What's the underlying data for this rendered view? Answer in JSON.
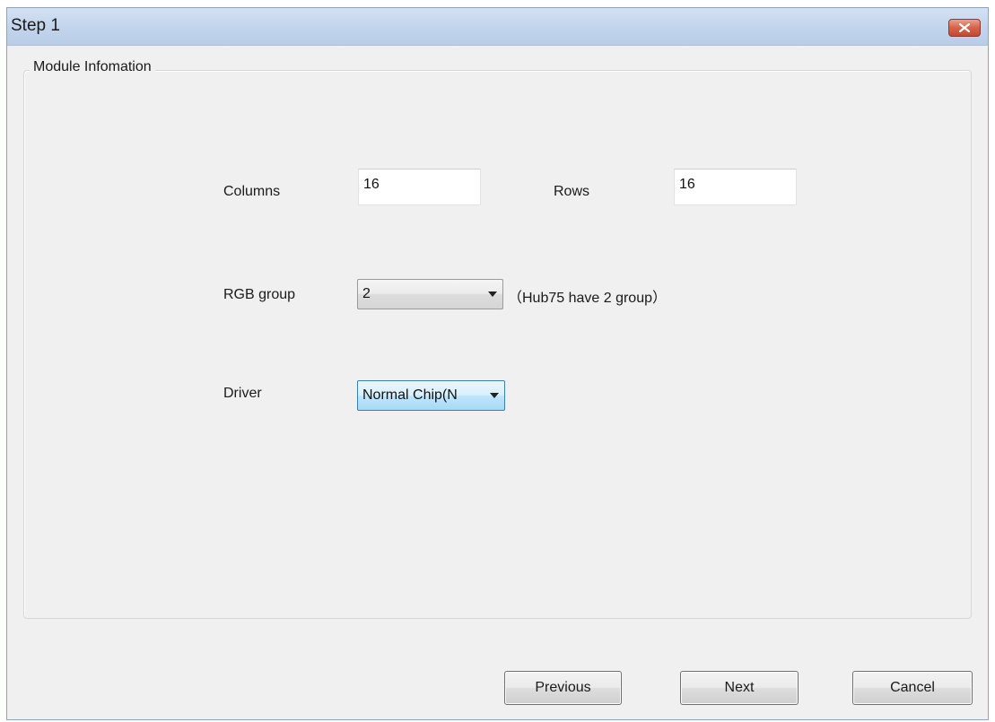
{
  "window": {
    "title": "Step 1"
  },
  "icons": {
    "close": "close-icon",
    "dropdown": "chevron-down-icon"
  },
  "colors": {
    "titlebar": "#c3d5ec",
    "close_button": "#d5634a",
    "focused_combo": "#bee6fd"
  },
  "group": {
    "legend": "Module Infomation"
  },
  "fields": {
    "columns_label": "Columns",
    "columns_value": "16",
    "rows_label": "Rows",
    "rows_value": "16",
    "rgb_group_label": "RGB group",
    "rgb_group_value": "2",
    "rgb_group_hint": "（Hub75 have 2 group）",
    "driver_label": "Driver",
    "driver_value": "Normal Chip(N"
  },
  "buttons": {
    "previous": "Previous",
    "next": "Next",
    "cancel": "Cancel"
  }
}
